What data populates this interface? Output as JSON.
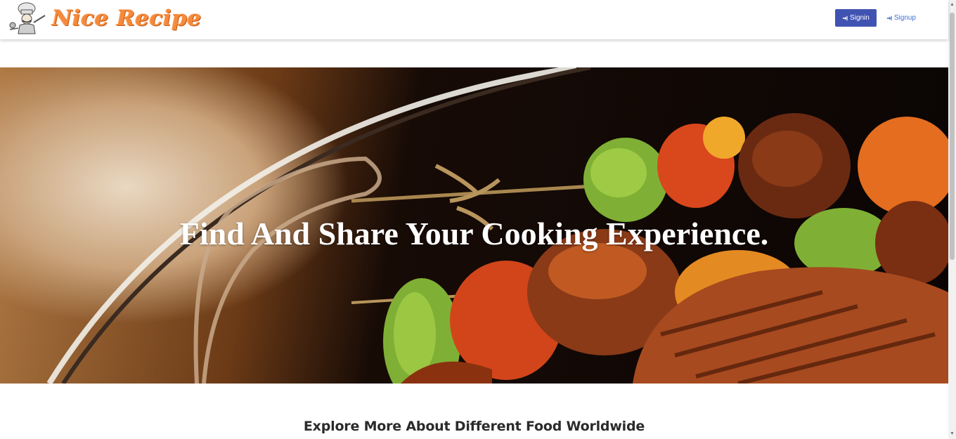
{
  "brand": {
    "name": "Nice Recipe"
  },
  "nav": {
    "signin_label": "Signin",
    "signup_label": "Signup"
  },
  "hero": {
    "title": "Find And Share Your Cooking Experience."
  },
  "section": {
    "title": "Explore More About Different Food Worldwide"
  },
  "colors": {
    "brand_orange": "#f58a3b",
    "signin_bg": "#4053b2",
    "signup_text": "#3f6fd8"
  }
}
